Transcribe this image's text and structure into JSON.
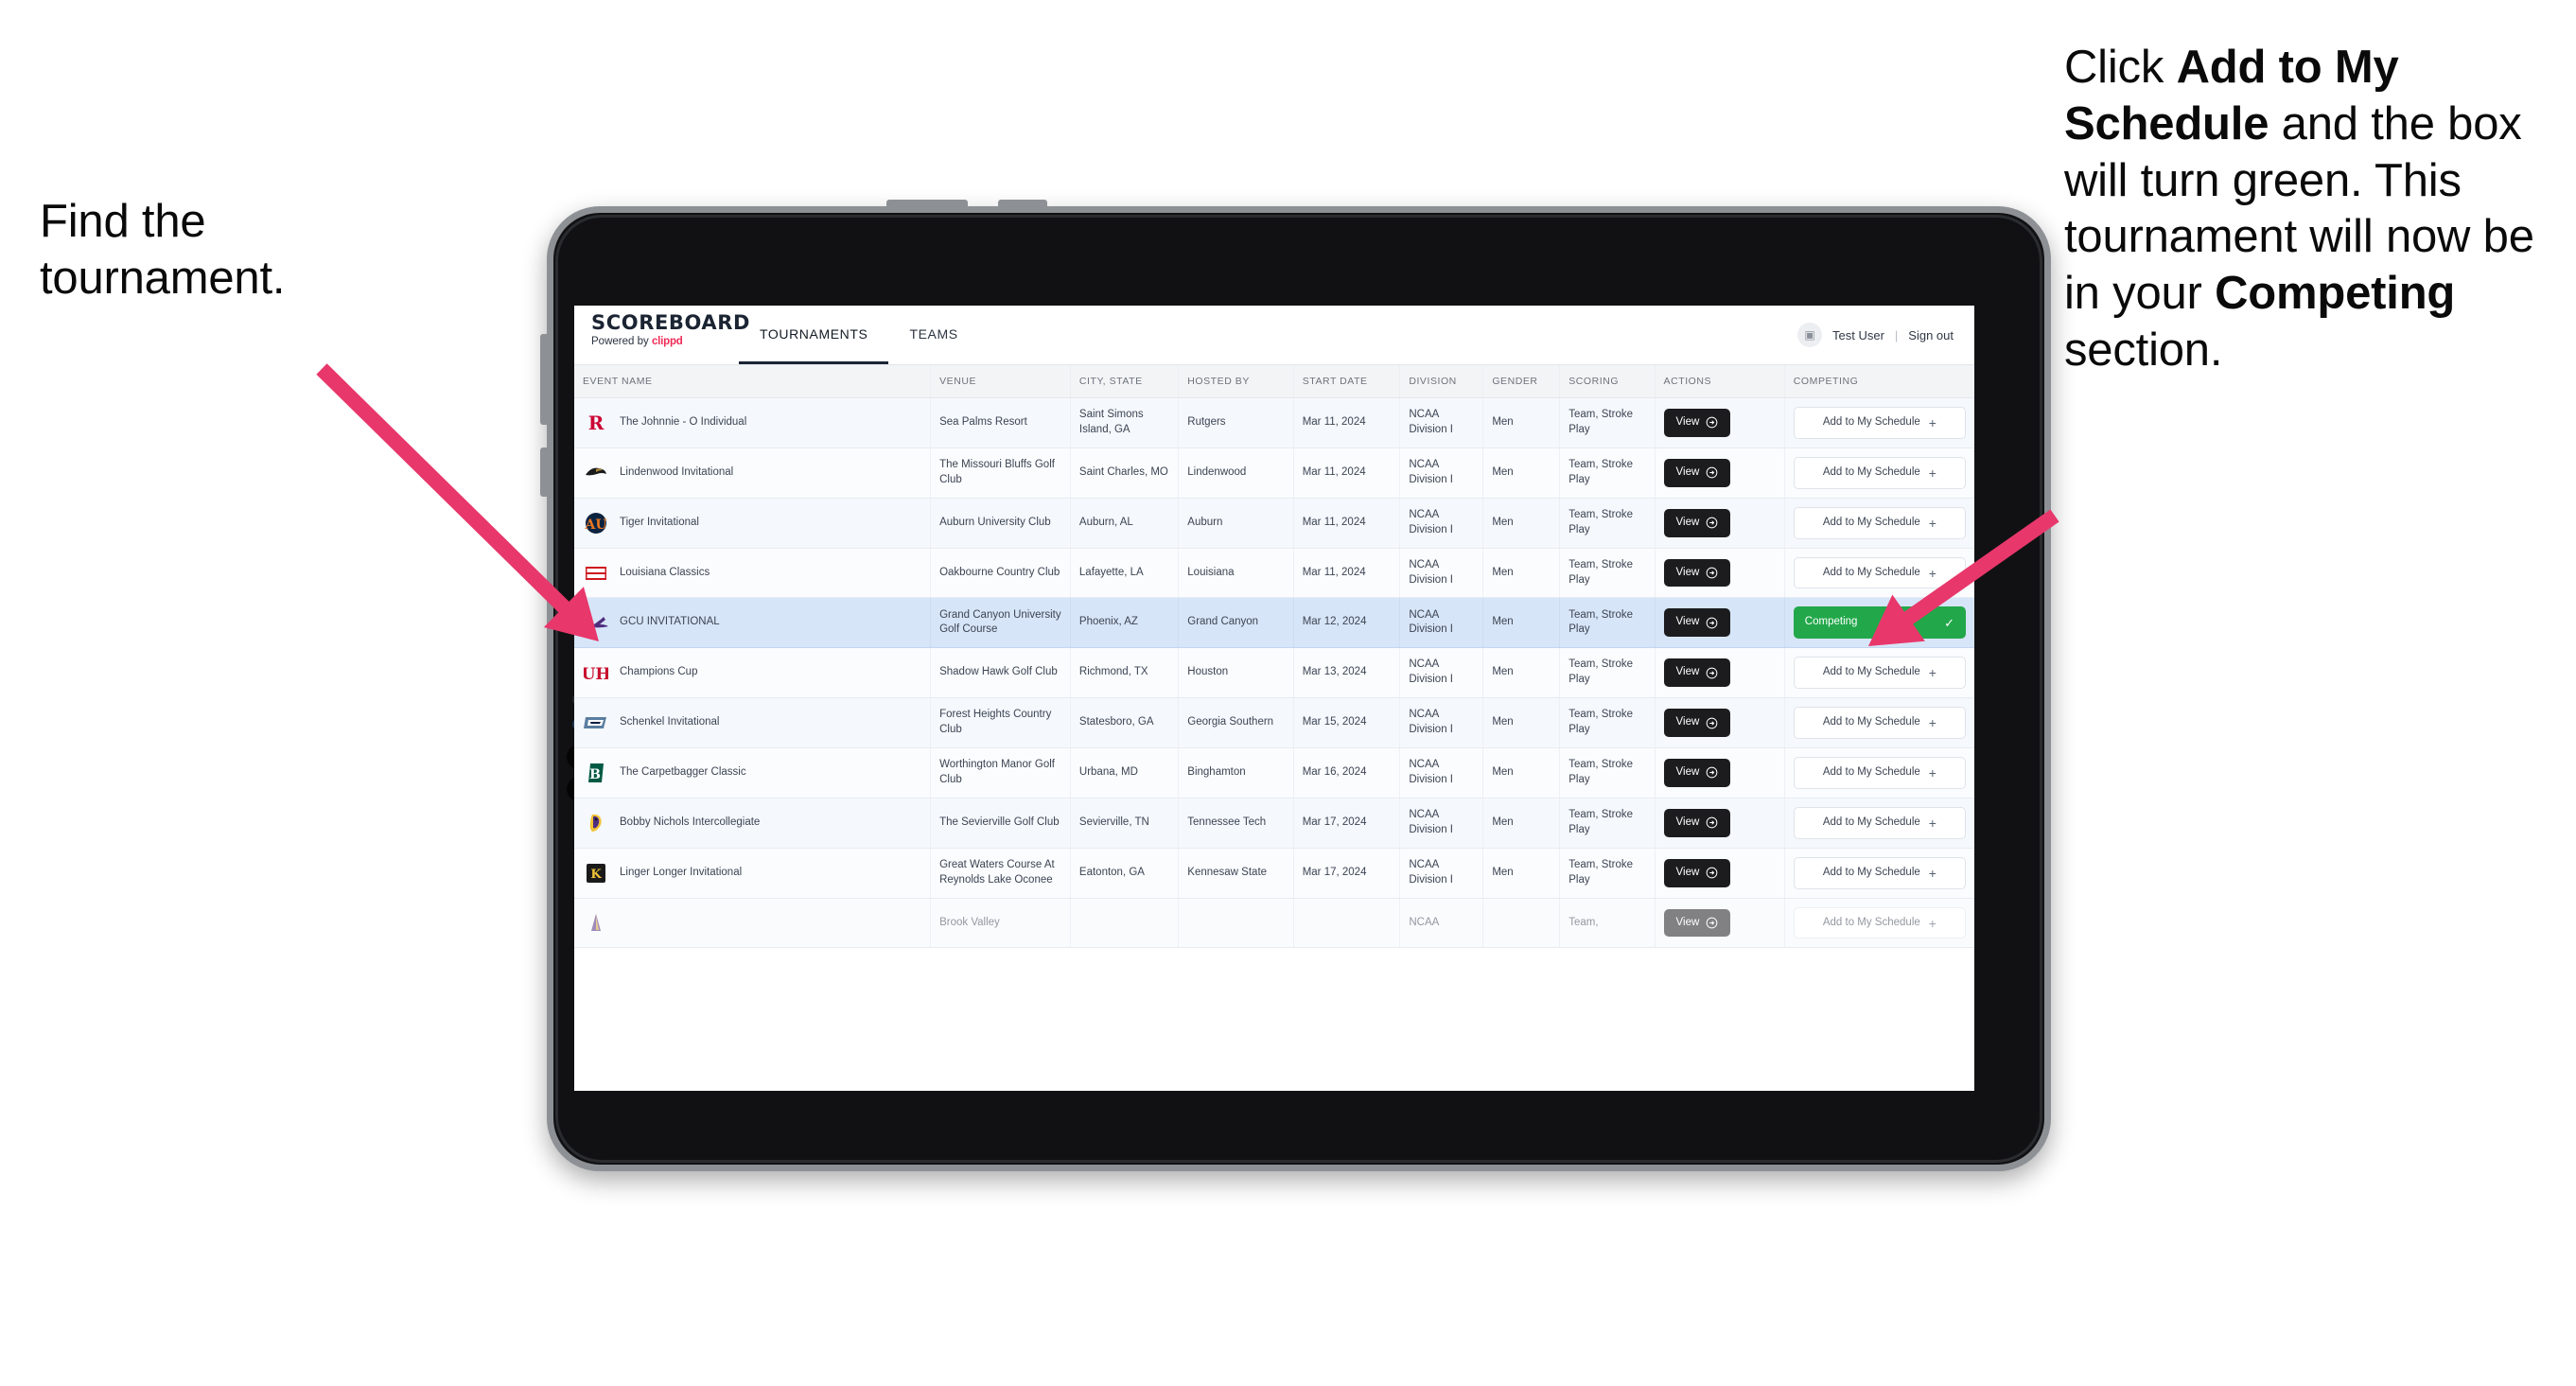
{
  "annotations": {
    "left": {
      "line1": "Find the",
      "line2": "tournament."
    },
    "right": {
      "part1": "Click ",
      "bold1": "Add to My Schedule",
      "part2": " and the box will turn green. This tournament will now be in your ",
      "bold2": "Competing",
      "part3": " section."
    },
    "arrow_color": "#e8376b"
  },
  "app": {
    "brand": {
      "title": "SCOREBOARD",
      "powered_prefix": "Powered by ",
      "powered_brand": "clippd",
      "brand_color": "#ef2b55"
    },
    "tabs": [
      {
        "label": "TOURNAMENTS",
        "active": true
      },
      {
        "label": "TEAMS",
        "active": false
      }
    ],
    "account": {
      "user": "Test User",
      "separator": "|",
      "sign_out": "Sign out",
      "avatar_glyph": "▣"
    }
  },
  "table": {
    "columns": [
      "EVENT NAME",
      "VENUE",
      "CITY, STATE",
      "HOSTED BY",
      "START DATE",
      "DIVISION",
      "GENDER",
      "SCORING",
      "ACTIONS",
      "COMPETING"
    ],
    "action_label": "View",
    "add_label": "Add to My Schedule",
    "add_plus": "+",
    "competing_label": "Competing",
    "competing_check": "✓",
    "competing_color": "#22a84a",
    "rows": [
      {
        "event": "The Johnnie - O Individual",
        "venue": "Sea Palms Resort",
        "city": "Saint Simons Island, GA",
        "host": "Rutgers",
        "date": "Mar 11, 2024",
        "division": "NCAA Division I",
        "gender": "Men",
        "scoring": "Team, Stroke Play",
        "competing": false,
        "logo": "rutgers-r"
      },
      {
        "event": "Lindenwood Invitational",
        "venue": "The Missouri Bluffs Golf Club",
        "city": "Saint Charles, MO",
        "host": "Lindenwood",
        "date": "Mar 11, 2024",
        "division": "NCAA Division I",
        "gender": "Men",
        "scoring": "Team, Stroke Play",
        "competing": false,
        "logo": "lindenwood-lion"
      },
      {
        "event": "Tiger Invitational",
        "venue": "Auburn University Club",
        "city": "Auburn, AL",
        "host": "Auburn",
        "date": "Mar 11, 2024",
        "division": "NCAA Division I",
        "gender": "Men",
        "scoring": "Team, Stroke Play",
        "competing": false,
        "logo": "auburn-au"
      },
      {
        "event": "Louisiana Classics",
        "venue": "Oakbourne Country Club",
        "city": "Lafayette, LA",
        "host": "Louisiana",
        "date": "Mar 11, 2024",
        "division": "NCAA Division I",
        "gender": "Men",
        "scoring": "Team, Stroke Play",
        "competing": false,
        "logo": "ragin-cajuns"
      },
      {
        "event": "GCU INVITATIONAL",
        "venue": "Grand Canyon University Golf Course",
        "city": "Phoenix, AZ",
        "host": "Grand Canyon",
        "date": "Mar 12, 2024",
        "division": "NCAA Division I",
        "gender": "Men",
        "scoring": "Team, Stroke Play",
        "competing": true,
        "logo": "gcu-lope"
      },
      {
        "event": "Champions Cup",
        "venue": "Shadow Hawk Golf Club",
        "city": "Richmond, TX",
        "host": "Houston",
        "date": "Mar 13, 2024",
        "division": "NCAA Division I",
        "gender": "Men",
        "scoring": "Team, Stroke Play",
        "competing": false,
        "logo": "houston-uh"
      },
      {
        "event": "Schenkel Invitational",
        "venue": "Forest Heights Country Club",
        "city": "Statesboro, GA",
        "host": "Georgia Southern",
        "date": "Mar 15, 2024",
        "division": "NCAA Division I",
        "gender": "Men",
        "scoring": "Team, Stroke Play",
        "competing": false,
        "logo": "georgia-southern-gs"
      },
      {
        "event": "The Carpetbagger Classic",
        "venue": "Worthington Manor Golf Club",
        "city": "Urbana, MD",
        "host": "Binghamton",
        "date": "Mar 16, 2024",
        "division": "NCAA Division I",
        "gender": "Men",
        "scoring": "Team, Stroke Play",
        "competing": false,
        "logo": "binghamton-b"
      },
      {
        "event": "Bobby Nichols Intercollegiate",
        "venue": "The Sevierville Golf Club",
        "city": "Sevierville, TN",
        "host": "Tennessee Tech",
        "date": "Mar 17, 2024",
        "division": "NCAA Division I",
        "gender": "Men",
        "scoring": "Team, Stroke Play",
        "competing": false,
        "logo": "tennessee-tech-eagle"
      },
      {
        "event": "Linger Longer Invitational",
        "venue": "Great Waters Course At Reynolds Lake Oconee",
        "city": "Eatonton, GA",
        "host": "Kennesaw State",
        "date": "Mar 17, 2024",
        "division": "NCAA Division I",
        "gender": "Men",
        "scoring": "Team, Stroke Play",
        "competing": false,
        "logo": "kennesaw-ks"
      },
      {
        "event": "",
        "venue": "Brook Valley",
        "city": "",
        "host": "",
        "date": "",
        "division": "NCAA",
        "gender": "",
        "scoring": "Team,",
        "competing": false,
        "logo": "partial"
      }
    ]
  }
}
